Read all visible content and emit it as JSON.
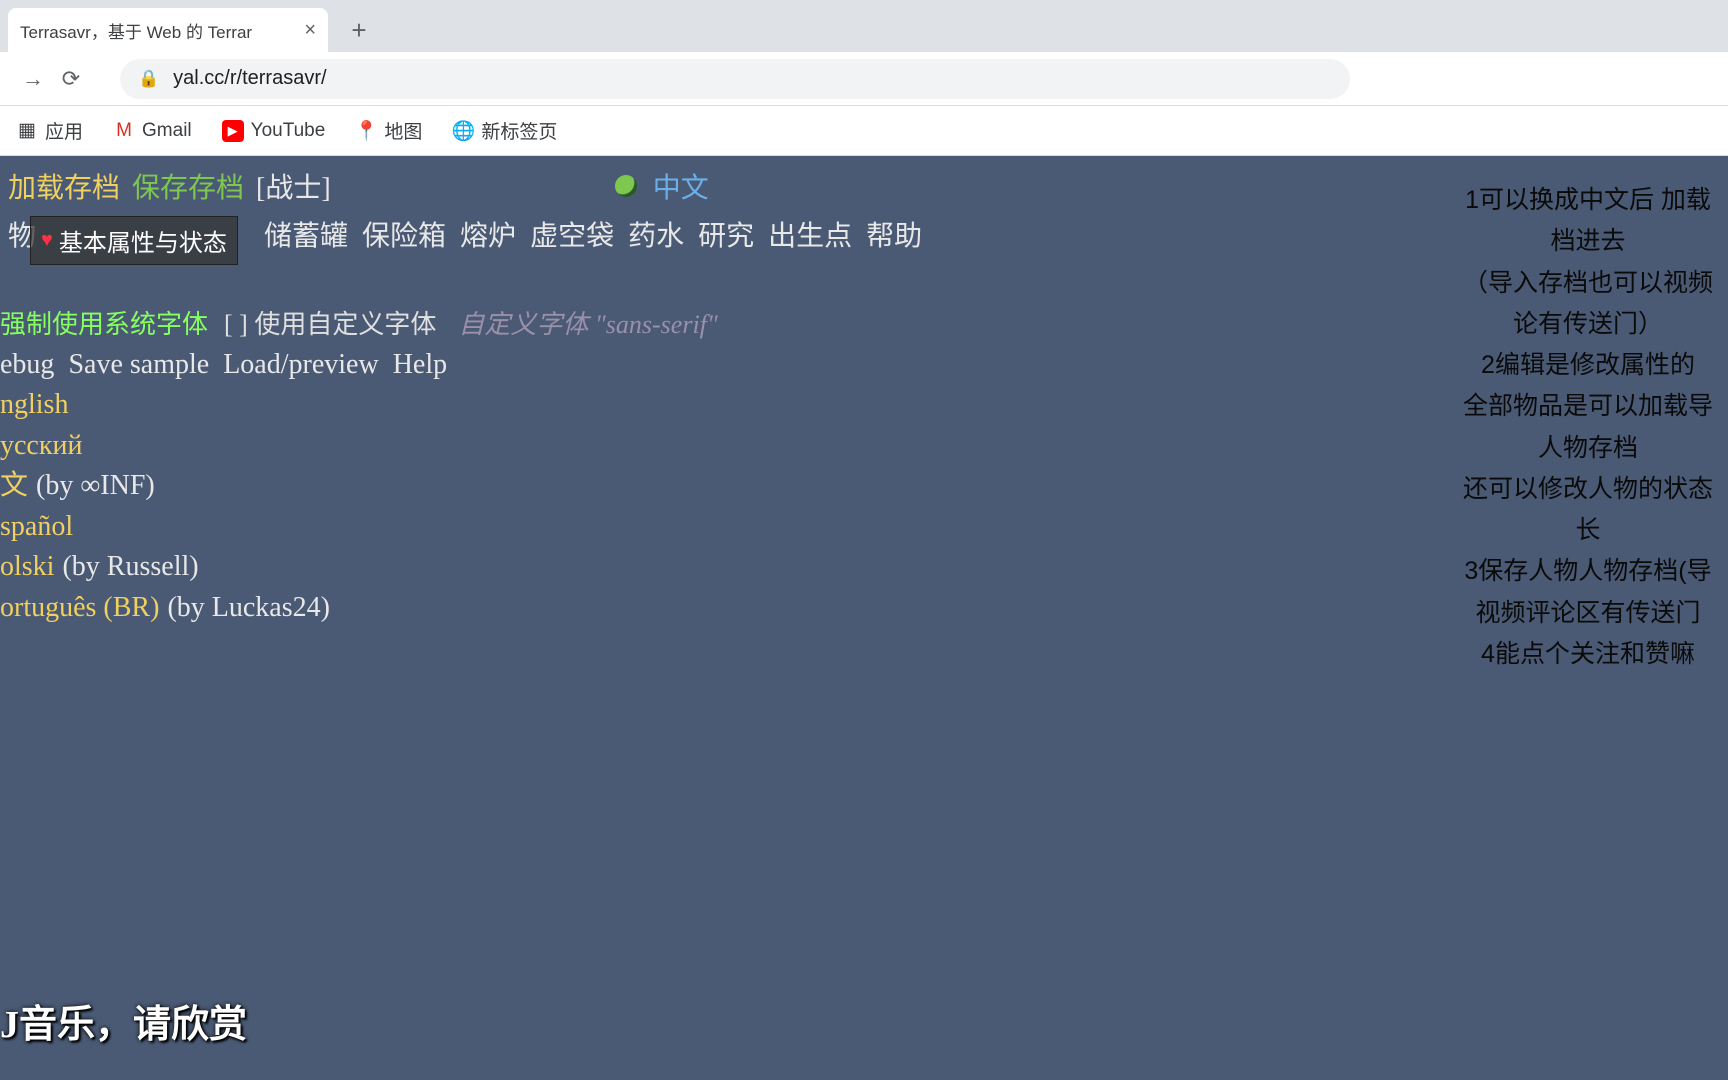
{
  "browser": {
    "tab_title": "Terrasavr，基于 Web 的 Terrar",
    "url": "yal.cc/r/terrasavr/",
    "bookmarks": {
      "apps": "应用",
      "gmail": "Gmail",
      "youtube": "YouTube",
      "maps": "地图",
      "newtab": "新标签页"
    }
  },
  "top": {
    "load": "加载存档",
    "save": "保存存档",
    "class": "[战士]",
    "lang": "中文"
  },
  "tabs": {
    "t1": "物",
    "t3": "储蓄罐",
    "t4": "保险箱",
    "t5": "熔炉",
    "t6": "虚空袋",
    "t7": "药水",
    "t8": "研究",
    "t9": "出生点",
    "t10": "帮助"
  },
  "tooltip": "基本属性与状态",
  "fontrow": {
    "force": "强制使用系统字体",
    "cb": "[ ]",
    "use_custom": "使用自定义字体",
    "custom": "自定义字体 \"sans-serif\""
  },
  "menu": {
    "debug": "ebug",
    "save_sample": "Save sample",
    "load_preview": "Load/preview",
    "help": "Help"
  },
  "langs": {
    "en": "nglish",
    "ru": "усский",
    "zh": "文",
    "zh_by": "(by ∞INF)",
    "es": "spañol",
    "pl": "olski",
    "pl_by": "(by Russell)",
    "pt": "ortuguês (BR)",
    "pt_by": "(by Luckas24)"
  },
  "bottom": "J音乐，请欣赏",
  "side": {
    "l1": "1可以换成中文后 加载",
    "l2": "档进去",
    "l3": "（导入存档也可以视频",
    "l4": "论有传送门）",
    "l5": "2编辑是修改属性的",
    "l6": "全部物品是可以加载导",
    "l7": "人物存档",
    "l8": "还可以修改人物的状态",
    "l9": "长",
    "l10": "3保存人物人物存档(导",
    "l11": "视频评论区有传送门",
    "l12": "4能点个关注和赞嘛"
  }
}
